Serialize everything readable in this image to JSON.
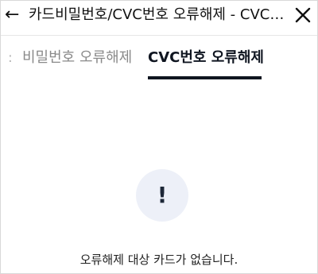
{
  "header": {
    "back_glyph": "←",
    "title": "카드비밀번호/CVC번호 오류해제 - CVC번호 오류해제",
    "close_icon": "close-icon"
  },
  "tabs": {
    "items": [
      {
        "label": "비밀번호 오류해제",
        "active": false
      },
      {
        "label": "CVC번호 오류해제",
        "active": true
      }
    ],
    "active_color": "#0f1520",
    "inactive_color": "#8a8a8a"
  },
  "empty_state": {
    "icon": "alert-icon",
    "icon_glyph": "!",
    "icon_bg": "#edf0f8",
    "message": "오류해제 대상 카드가 없습니다."
  }
}
